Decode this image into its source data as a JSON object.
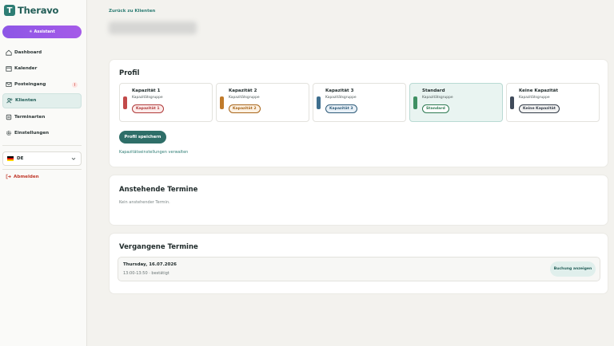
{
  "app": {
    "logo_letter": "T",
    "name": "Theravo"
  },
  "sidebar": {
    "assistant_label": "Assistant",
    "items": [
      {
        "label": "Dashboard",
        "icon": "home-icon"
      },
      {
        "label": "Kalender",
        "icon": "calendar-icon"
      },
      {
        "label": "Posteingang",
        "icon": "inbox-icon",
        "badge": "!"
      },
      {
        "label": "Klienten",
        "icon": "users-icon",
        "active": true
      },
      {
        "label": "Terminarten",
        "icon": "layers-icon"
      },
      {
        "label": "Einstellungen",
        "icon": "gear-icon"
      }
    ],
    "language": "DE",
    "logout_label": "Abmelden"
  },
  "main": {
    "back_label": "Zurück zu Klienten",
    "profile": {
      "title": "Profil",
      "capacities": [
        {
          "title": "Kapazität 1",
          "sub": "Kapazitätsgruppe",
          "pill": "Kapazität 1",
          "color": "#c24a4a",
          "pill_bg": "#fdeceb",
          "pill_fg": "#b03a3a",
          "selected": false
        },
        {
          "title": "Kapazität 2",
          "sub": "Kapazitätsgruppe",
          "pill": "Kapazität 2",
          "color": "#c07a2a",
          "pill_bg": "#fdf1e2",
          "pill_fg": "#a8651a",
          "selected": false
        },
        {
          "title": "Kapazität 3",
          "sub": "Kapazitätsgruppe",
          "pill": "Kapazität 3",
          "color": "#3f6f8f",
          "pill_bg": "#e8f0f7",
          "pill_fg": "#2f5c7a",
          "selected": false
        },
        {
          "title": "Standard",
          "sub": "Kapazitätsgruppe",
          "pill": "Standard",
          "color": "#3f8f63",
          "pill_bg": "#ffffff",
          "pill_fg": "#2e7a52",
          "selected": true
        },
        {
          "title": "Keine Kapazität",
          "sub": "Kapazitätsgruppe",
          "pill": "Keine Kapazität",
          "color": "#3f4a5a",
          "pill_bg": "#f3f3f3",
          "pill_fg": "#333c48",
          "selected": false
        }
      ],
      "save_label": "Profil speichern",
      "manage_link": "Kapazitätseinstellungen verwalten"
    },
    "upcoming": {
      "title": "Anstehende Termine",
      "empty": "Kein anstehender Termin."
    },
    "past": {
      "title": "Vergangene Termine",
      "appointments": [
        {
          "date": "Thursday, 16.07.2026",
          "time": "13:00-13:50 · bestätigt",
          "action": "Buchung anzeigen"
        }
      ]
    }
  }
}
